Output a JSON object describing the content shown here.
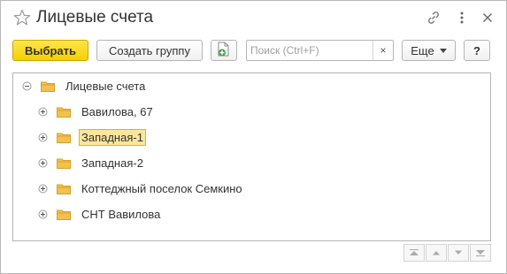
{
  "window": {
    "title": "Лицевые счета"
  },
  "title_bar": {
    "favorite_icon": "star-icon",
    "link_icon": "link-icon",
    "more_icon": "more-vertical-icon",
    "close_icon": "close-icon"
  },
  "toolbar": {
    "select_label": "Выбрать",
    "create_group_label": "Создать группу",
    "add_icon": "add-document-icon",
    "search_placeholder": "Поиск (Ctrl+F)",
    "search_value": "",
    "search_clear": "×",
    "more_label": "Еще",
    "help_label": "?"
  },
  "tree": {
    "root": {
      "label": "Лицевые счета",
      "expanded": true,
      "icon": "folder-icon"
    },
    "items": [
      {
        "label": "Вавилова, 67",
        "expanded": false,
        "selected": false
      },
      {
        "label": "Западная-1",
        "expanded": false,
        "selected": true
      },
      {
        "label": "Западная-2",
        "expanded": false,
        "selected": false
      },
      {
        "label": "Коттеджный поселок Семкино",
        "expanded": false,
        "selected": false
      },
      {
        "label": "СНТ Вавилова",
        "expanded": false,
        "selected": false
      }
    ]
  },
  "navigation": {
    "first_icon": "first-page-icon",
    "prev_icon": "prev-page-icon",
    "next_icon": "next-page-icon",
    "last_icon": "last-page-icon"
  },
  "colors": {
    "primary_button": "#f5cf00",
    "selection_bg": "#fbe69a",
    "selection_border": "#e0b900",
    "folder": "#f2c14e",
    "add_icon_green": "#3aa64a"
  }
}
